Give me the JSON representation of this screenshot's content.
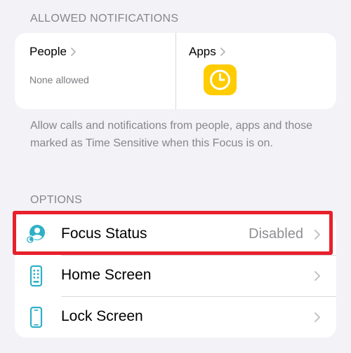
{
  "allowed_notifications": {
    "header": "ALLOWED NOTIFICATIONS",
    "people": {
      "title": "People",
      "subtitle": "None allowed"
    },
    "apps": {
      "title": "Apps",
      "app_icons": [
        "clock-app-icon"
      ]
    },
    "footnote": "Allow calls and notifications from people, apps and those marked as Time Sensitive when this Focus is on."
  },
  "options": {
    "header": "OPTIONS",
    "rows": [
      {
        "label": "Focus Status",
        "value": "Disabled",
        "icon": "focus-status-icon"
      },
      {
        "label": "Home Screen",
        "value": "",
        "icon": "home-screen-icon"
      },
      {
        "label": "Lock Screen",
        "value": "",
        "icon": "lock-screen-icon"
      }
    ]
  },
  "colors": {
    "background": "#f2f2f7",
    "accent_teal": "#30b0c7",
    "clock_yellow": "#ffcc00",
    "highlight_red": "#e8202c",
    "secondary_text": "#86868b"
  }
}
